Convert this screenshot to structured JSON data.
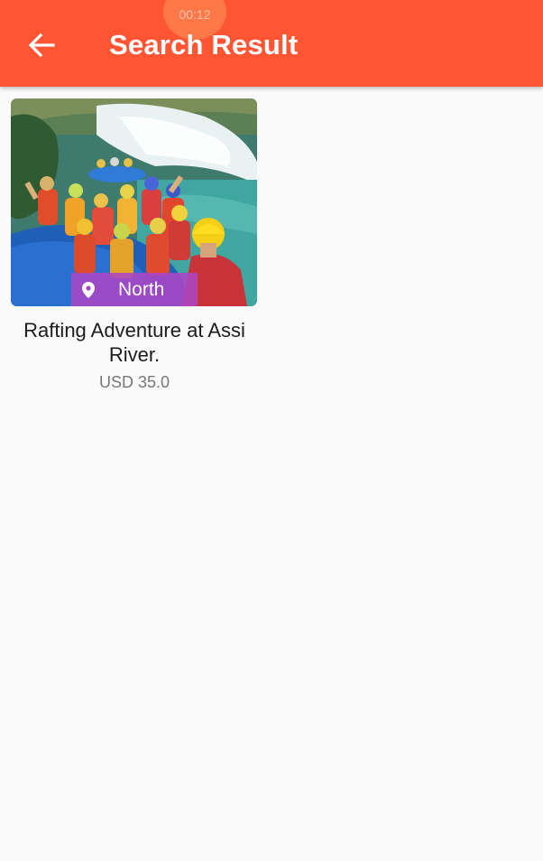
{
  "status_bar": {
    "time": "00:12"
  },
  "app_bar": {
    "title": "Search Result",
    "back_icon": "arrow-left-icon",
    "background_color": "#ff5533"
  },
  "results": [
    {
      "title": "Rafting Adventure at Assi River.",
      "price": "USD 35.0",
      "location": "North",
      "location_icon": "map-pin-icon",
      "badge_color": "#ac46c4"
    }
  ]
}
